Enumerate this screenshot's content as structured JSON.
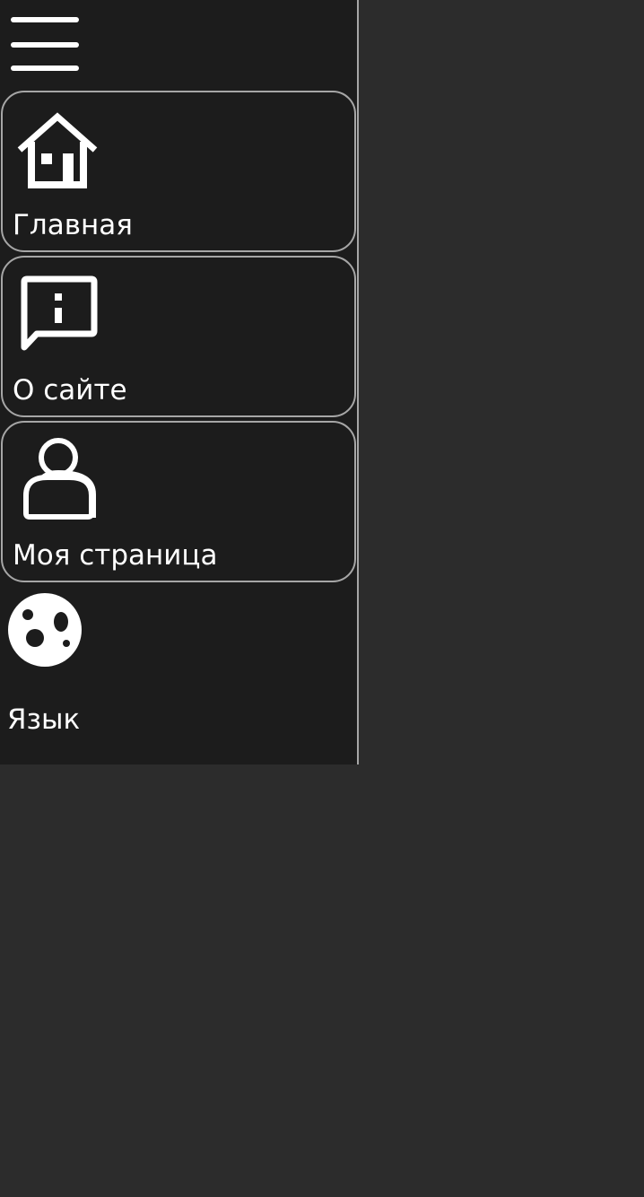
{
  "sidebar": {
    "menu_icon": "hamburger-menu-icon",
    "items": [
      {
        "label": "Главная",
        "icon": "home-icon"
      },
      {
        "label": "О сайте",
        "icon": "info-message-icon"
      },
      {
        "label": "Моя страница",
        "icon": "user-icon"
      }
    ],
    "language": {
      "label": "Язык",
      "icon": "palette-icon"
    }
  },
  "colors": {
    "page_background": "#2c2c2c",
    "sidebar_background": "#1c1c1c",
    "border": "#a6a6a6",
    "text": "#ffffff"
  }
}
